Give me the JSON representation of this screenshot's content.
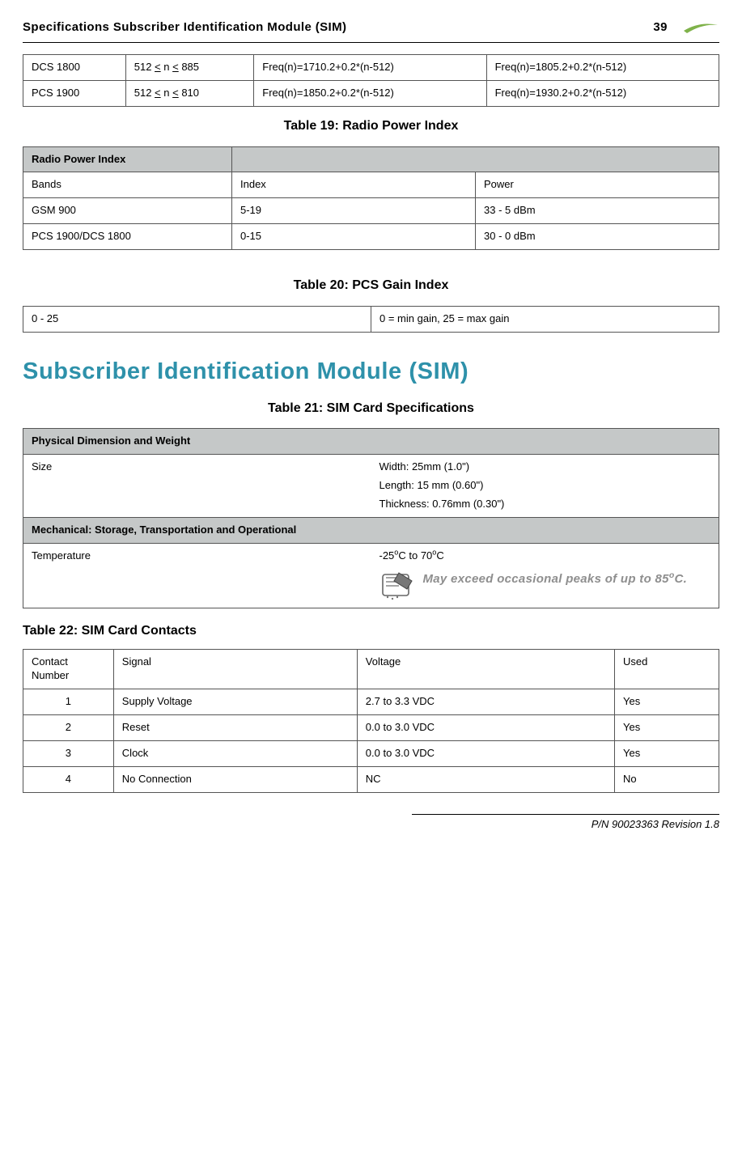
{
  "header": {
    "left": "Specifications  Subscriber Identification Module (SIM)",
    "page_number": "39"
  },
  "table_freq": {
    "rows": [
      [
        "DCS 1800",
        "512 ≤ n ≤ 885",
        "Freq(n)=1710.2+0.2*(n-512)",
        "Freq(n)=1805.2+0.2*(n-512)"
      ],
      [
        "PCS 1900",
        "512 ≤ n ≤ 810",
        "Freq(n)=1850.2+0.2*(n-512)",
        "Freq(n)=1930.2+0.2*(n-512)"
      ]
    ]
  },
  "table19": {
    "caption": "Table 19: Radio Power Index",
    "title": "Radio Power Index",
    "headers": [
      "Bands",
      "Index",
      "Power"
    ],
    "rows": [
      [
        "GSM 900",
        "5-19",
        "33 - 5 dBm"
      ],
      [
        "PCS 1900/DCS 1800",
        "0-15",
        "30 - 0 dBm"
      ]
    ]
  },
  "table20": {
    "caption": "Table 20: PCS Gain Index",
    "rows": [
      [
        "0 - 25",
        "0 = min gain, 25 = max gain"
      ]
    ]
  },
  "sim_heading": "Subscriber Identification Module (SIM)",
  "table21": {
    "caption": "Table 21: SIM Card Specifications",
    "section1": "Physical Dimension and Weight",
    "size_label": "Size",
    "size_lines": [
      "Width: 25mm (1.0\")",
      "Length: 15 mm (0.60\")",
      "Thickness: 0.76mm (0.30\")"
    ],
    "section2": "Mechanical: Storage, Transportation and Operational",
    "temp_label": "Temperature",
    "temp_value_prefix": "-25",
    "temp_value_mid": "C to 70",
    "temp_value_suffix": "C",
    "note_prefix": "May exceed occasional peaks of up to 85",
    "note_suffix": "C."
  },
  "table22": {
    "caption": "Table 22: SIM Card Contacts",
    "headers": [
      "Contact Number",
      "Signal",
      "Voltage",
      "Used"
    ],
    "rows": [
      [
        "1",
        "Supply Voltage",
        "2.7 to 3.3 VDC",
        "Yes"
      ],
      [
        "2",
        "Reset",
        "0.0 to 3.0 VDC",
        "Yes"
      ],
      [
        "3",
        "Clock",
        "0.0 to 3.0 VDC",
        "Yes"
      ],
      [
        "4",
        "No Connection",
        "NC",
        "No"
      ]
    ]
  },
  "footer": "P/N 90023363  Revision 1.8"
}
